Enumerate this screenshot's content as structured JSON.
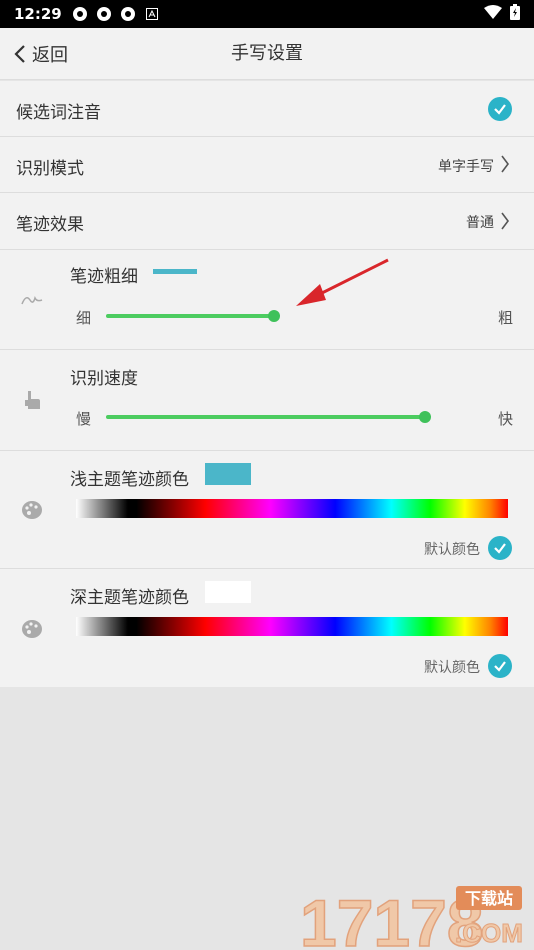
{
  "status": {
    "time": "12:29"
  },
  "nav": {
    "back_label": "返回",
    "title": "手写设置"
  },
  "settings": {
    "pinyin_label": "候选词注音",
    "recog_mode_label": "识别模式",
    "recog_mode_value": "单字手写",
    "stroke_effect_label": "笔迹效果",
    "stroke_effect_value": "普通"
  },
  "thickness": {
    "title": "笔迹粗细",
    "min_label": "细",
    "max_label": "粗",
    "level": 0.42,
    "swatch_color": "#4bb6c9"
  },
  "speed": {
    "title": "识别速度",
    "min_label": "慢",
    "max_label": "快",
    "level": 1.0
  },
  "light_color": {
    "title": "浅主题笔迹颜色",
    "swatch_color": "#4bb6c9",
    "default_label": "默认颜色"
  },
  "dark_color": {
    "title": "深主题笔迹颜色",
    "swatch_color": "#ffffff",
    "default_label": "默认颜色"
  },
  "watermark": {
    "digits": "17178",
    "site": "下载站",
    "domain": ".COM"
  }
}
